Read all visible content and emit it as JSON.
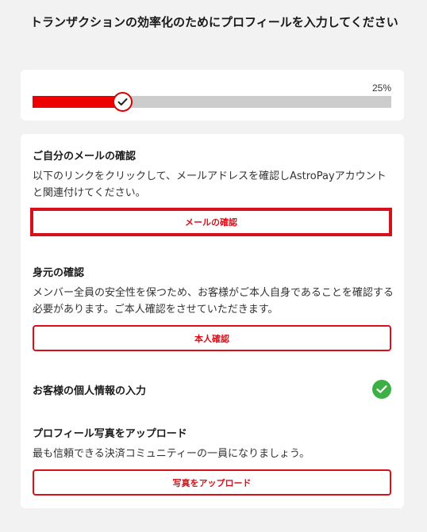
{
  "header": {
    "title": "トランザクションの効率化のためにプロフィールを入力してください"
  },
  "progress": {
    "value_percent": 25,
    "label": "25%",
    "fill_color": "#ee0000",
    "track_color": "#cccccc",
    "knob_icon": "checkmark-icon"
  },
  "steps": {
    "email": {
      "title": "ご自分のメールの確認",
      "description": "以下のリンクをクリックして、メールアドレスを確認しAstroPayアカウントと関連付けてください。",
      "button_label": "メールの確認"
    },
    "identity": {
      "title": "身元の確認",
      "description": "メンバー全員の安全性を保つため、お客様がご本人自身であることを確認する必要があります。ご本人確認をさせていただきます。",
      "button_label": "本人確認"
    },
    "personal_info": {
      "title": "お客様の個人情報の入力",
      "status_icon": "check-circle-icon",
      "status_color": "#3cb043"
    },
    "photo": {
      "title": "プロフィール写真をアップロード",
      "description": "最も信頼できる決済コミュニティーの一員になりましょう。",
      "button_label": "写真をアップロード"
    }
  },
  "colors": {
    "accent": "#d8101a",
    "background": "#f2f2f2",
    "card": "#ffffff"
  }
}
